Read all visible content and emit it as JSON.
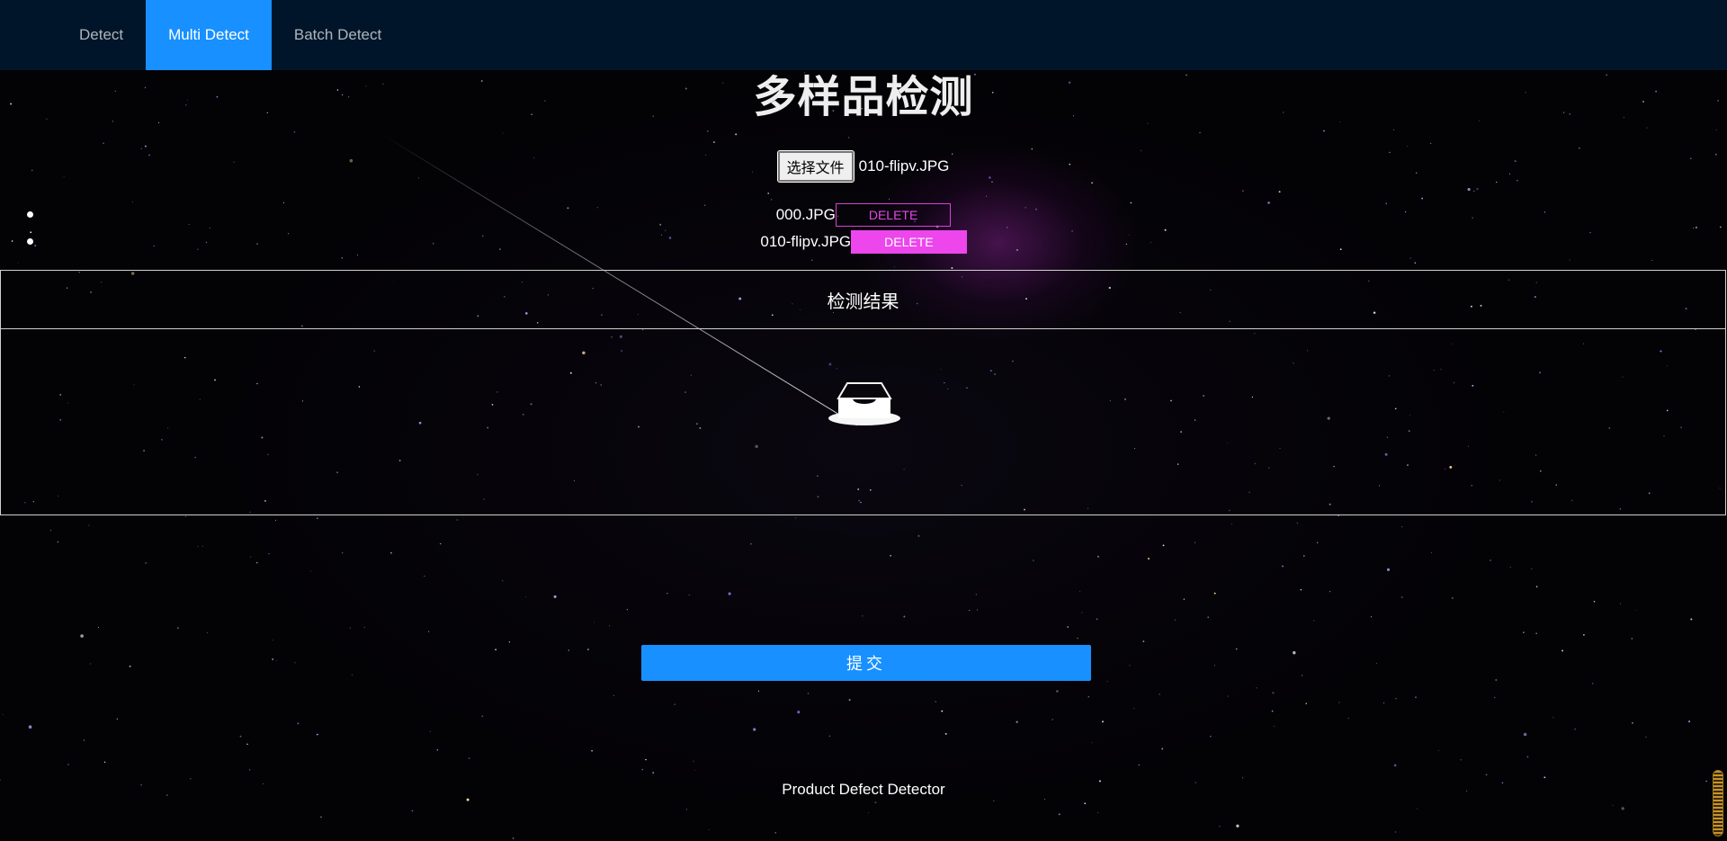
{
  "nav": {
    "items": [
      {
        "label": "Detect",
        "active": false
      },
      {
        "label": "Multi Detect",
        "active": true
      },
      {
        "label": "Batch Detect",
        "active": false
      }
    ],
    "background": "#001529",
    "active_color": "#1890ff"
  },
  "page": {
    "title": "多样品检测"
  },
  "upload": {
    "button_label": "选择文件",
    "selected_file": "010-flipv.JPG"
  },
  "files": [
    {
      "name": "000.JPG",
      "action_label": "DELETE",
      "style": "outline"
    },
    {
      "name": "010-flipv.JPG",
      "action_label": "DELETE",
      "style": "filled"
    }
  ],
  "result": {
    "header": "检测结果",
    "empty_icon": "empty-inbox-icon"
  },
  "submit": {
    "label": "提交",
    "color": "#1890ff"
  },
  "footer": {
    "text": "Product Defect Detector"
  },
  "colors": {
    "delete_accent": "#ec46ec"
  }
}
